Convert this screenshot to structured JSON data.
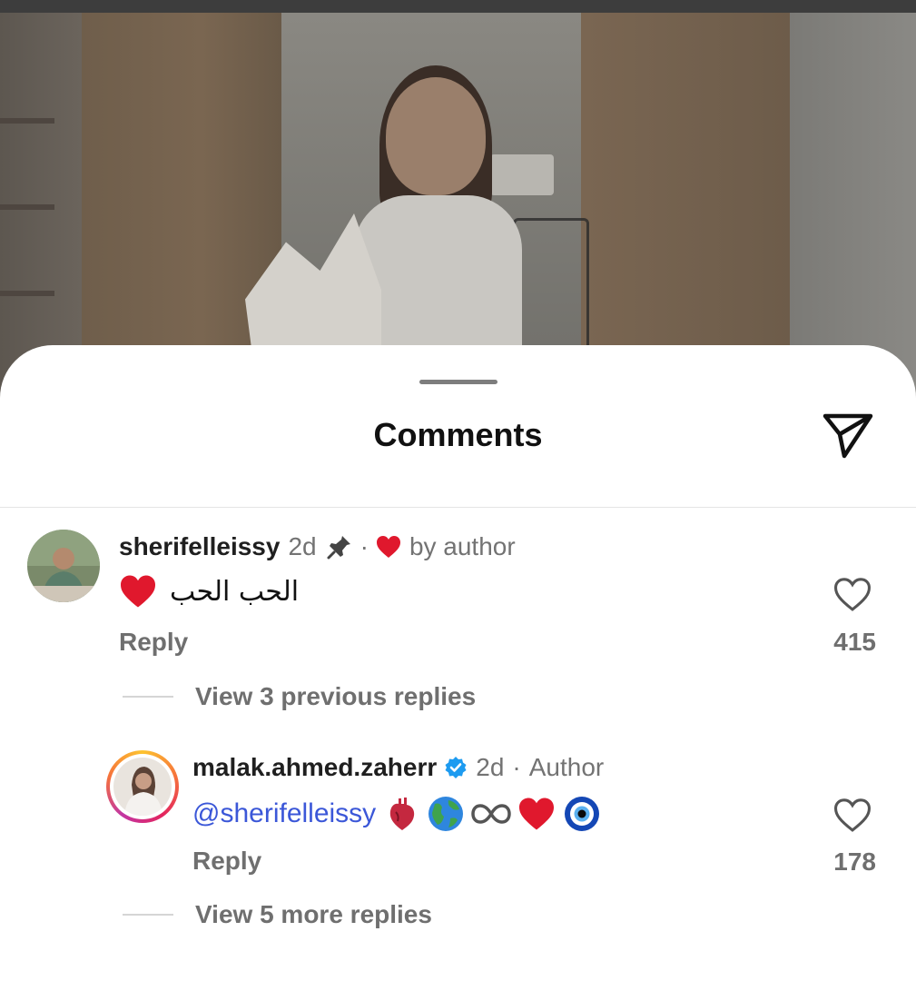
{
  "sheet": {
    "title": "Comments"
  },
  "comments": [
    {
      "username": "sherifelleissy",
      "time": "2d",
      "pinned": true,
      "liked_by_label": "by author",
      "text": "الحب الحب",
      "reply_label": "Reply",
      "likes": "415",
      "view_replies_label": "View 3 previous replies"
    },
    {
      "username": "malak.ahmed.zaherr",
      "verified": true,
      "time": "2d",
      "separator": "·",
      "role": "Author",
      "mention": "@sherifelleissy",
      "reply_label": "Reply",
      "likes": "178",
      "view_replies_label": "View 5 more replies"
    }
  ],
  "colors": {
    "like_heart": "#e0182d",
    "verified_badge": "#1d9bf0",
    "mention": "#3b57d8",
    "secondary_text": "#737373"
  }
}
